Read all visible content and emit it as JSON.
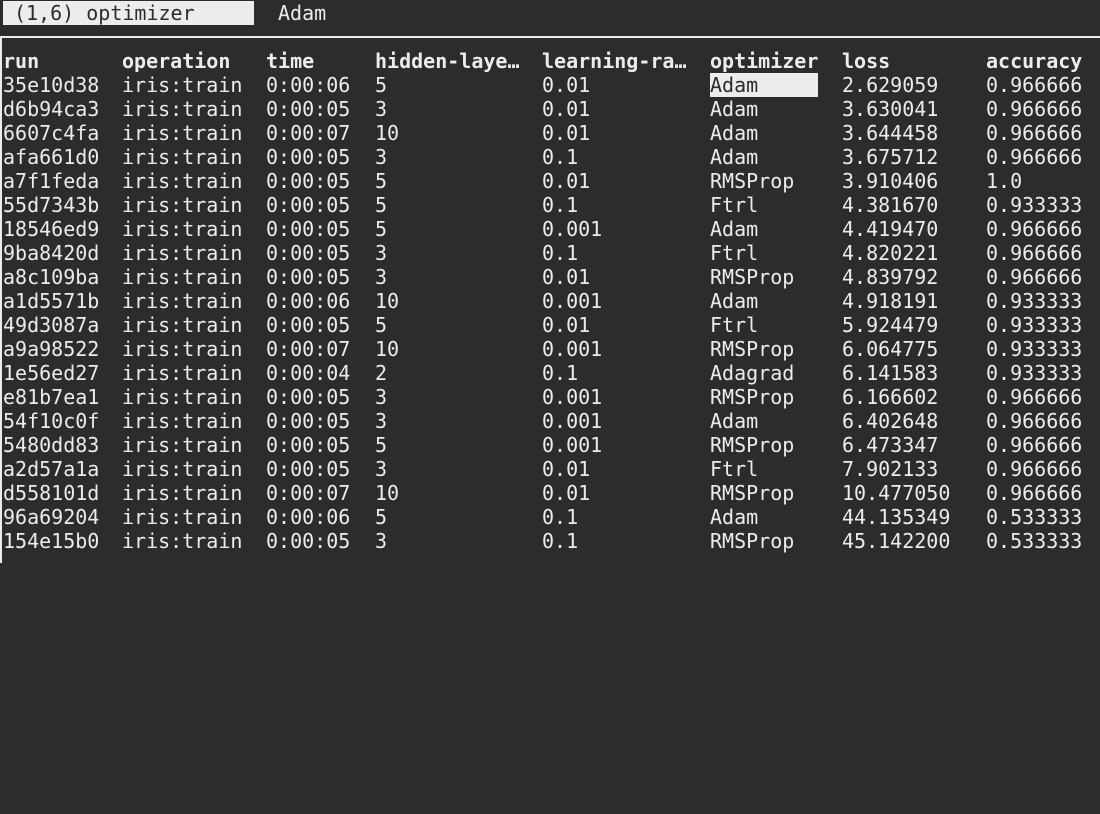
{
  "status": {
    "position_label": "(1,6) optimizer",
    "current_value": "Adam"
  },
  "columns": [
    "run",
    "operation",
    "time",
    "hidden-laye…",
    "learning-ra…",
    "optimizer",
    "loss",
    "accuracy"
  ],
  "selected_cell": {
    "row": 0,
    "column": "optimizer"
  },
  "rows": [
    {
      "run": "35e10d38",
      "operation": "iris:train",
      "time": "0:00:06",
      "hidden": "5",
      "lr": "0.01",
      "optimizer": "Adam",
      "loss": "2.629059",
      "accuracy": "0.966666"
    },
    {
      "run": "d6b94ca3",
      "operation": "iris:train",
      "time": "0:00:05",
      "hidden": "3",
      "lr": "0.01",
      "optimizer": "Adam",
      "loss": "3.630041",
      "accuracy": "0.966666"
    },
    {
      "run": "6607c4fa",
      "operation": "iris:train",
      "time": "0:00:07",
      "hidden": "10",
      "lr": "0.01",
      "optimizer": "Adam",
      "loss": "3.644458",
      "accuracy": "0.966666"
    },
    {
      "run": "afa661d0",
      "operation": "iris:train",
      "time": "0:00:05",
      "hidden": "3",
      "lr": "0.1",
      "optimizer": "Adam",
      "loss": "3.675712",
      "accuracy": "0.966666"
    },
    {
      "run": "a7f1feda",
      "operation": "iris:train",
      "time": "0:00:05",
      "hidden": "5",
      "lr": "0.01",
      "optimizer": "RMSProp",
      "loss": "3.910406",
      "accuracy": "1.0"
    },
    {
      "run": "55d7343b",
      "operation": "iris:train",
      "time": "0:00:05",
      "hidden": "5",
      "lr": "0.1",
      "optimizer": "Ftrl",
      "loss": "4.381670",
      "accuracy": "0.933333"
    },
    {
      "run": "18546ed9",
      "operation": "iris:train",
      "time": "0:00:05",
      "hidden": "5",
      "lr": "0.001",
      "optimizer": "Adam",
      "loss": "4.419470",
      "accuracy": "0.966666"
    },
    {
      "run": "9ba8420d",
      "operation": "iris:train",
      "time": "0:00:05",
      "hidden": "3",
      "lr": "0.1",
      "optimizer": "Ftrl",
      "loss": "4.820221",
      "accuracy": "0.966666"
    },
    {
      "run": "a8c109ba",
      "operation": "iris:train",
      "time": "0:00:05",
      "hidden": "3",
      "lr": "0.01",
      "optimizer": "RMSProp",
      "loss": "4.839792",
      "accuracy": "0.966666"
    },
    {
      "run": "a1d5571b",
      "operation": "iris:train",
      "time": "0:00:06",
      "hidden": "10",
      "lr": "0.001",
      "optimizer": "Adam",
      "loss": "4.918191",
      "accuracy": "0.933333"
    },
    {
      "run": "49d3087a",
      "operation": "iris:train",
      "time": "0:00:05",
      "hidden": "5",
      "lr": "0.01",
      "optimizer": "Ftrl",
      "loss": "5.924479",
      "accuracy": "0.933333"
    },
    {
      "run": "a9a98522",
      "operation": "iris:train",
      "time": "0:00:07",
      "hidden": "10",
      "lr": "0.001",
      "optimizer": "RMSProp",
      "loss": "6.064775",
      "accuracy": "0.933333"
    },
    {
      "run": "1e56ed27",
      "operation": "iris:train",
      "time": "0:00:04",
      "hidden": "2",
      "lr": "0.1",
      "optimizer": "Adagrad",
      "loss": "6.141583",
      "accuracy": "0.933333"
    },
    {
      "run": "e81b7ea1",
      "operation": "iris:train",
      "time": "0:00:05",
      "hidden": "3",
      "lr": "0.001",
      "optimizer": "RMSProp",
      "loss": "6.166602",
      "accuracy": "0.966666"
    },
    {
      "run": "54f10c0f",
      "operation": "iris:train",
      "time": "0:00:05",
      "hidden": "3",
      "lr": "0.001",
      "optimizer": "Adam",
      "loss": "6.402648",
      "accuracy": "0.966666"
    },
    {
      "run": "5480dd83",
      "operation": "iris:train",
      "time": "0:00:05",
      "hidden": "5",
      "lr": "0.001",
      "optimizer": "RMSProp",
      "loss": "6.473347",
      "accuracy": "0.966666"
    },
    {
      "run": "a2d57a1a",
      "operation": "iris:train",
      "time": "0:00:05",
      "hidden": "3",
      "lr": "0.01",
      "optimizer": "Ftrl",
      "loss": "7.902133",
      "accuracy": "0.966666"
    },
    {
      "run": "d558101d",
      "operation": "iris:train",
      "time": "0:00:07",
      "hidden": "10",
      "lr": "0.01",
      "optimizer": "RMSProp",
      "loss": "10.477050",
      "accuracy": "0.966666"
    },
    {
      "run": "96a69204",
      "operation": "iris:train",
      "time": "0:00:06",
      "hidden": "5",
      "lr": "0.1",
      "optimizer": "Adam",
      "loss": "44.135349",
      "accuracy": "0.533333"
    },
    {
      "run": "154e15b0",
      "operation": "iris:train",
      "time": "0:00:05",
      "hidden": "3",
      "lr": "0.1",
      "optimizer": "RMSProp",
      "loss": "45.142200",
      "accuracy": "0.533333"
    }
  ]
}
